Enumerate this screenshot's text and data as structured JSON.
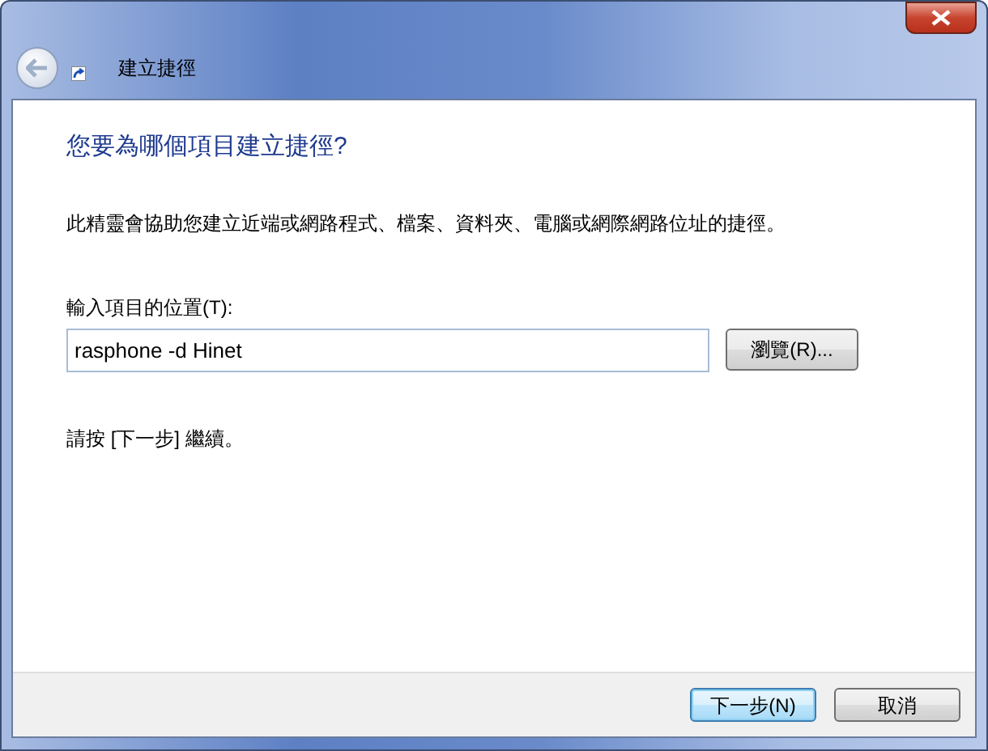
{
  "window": {
    "title": "建立捷徑"
  },
  "heading": "您要為哪個項目建立捷徑?",
  "description": "此精靈會協助您建立近端或網路程式、檔案、資料夾、電腦或網際網路位址的捷徑。",
  "location": {
    "label": "輸入項目的位置(T):",
    "value": "rasphone -d Hinet",
    "browse_button": "瀏覽(R)..."
  },
  "hint": "請按 [下一步] 繼續。",
  "buttons": [
    {
      "label": "下一步(N)",
      "selected": true
    },
    {
      "label": "取消",
      "selected": false
    }
  ]
}
